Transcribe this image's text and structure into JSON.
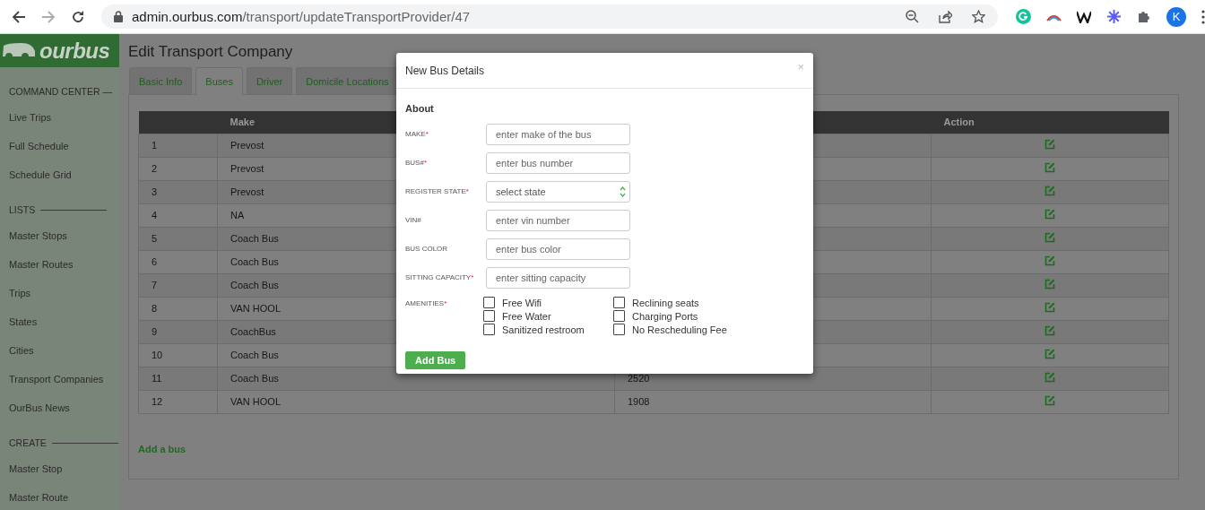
{
  "browser": {
    "url_host": "admin.ourbus.com",
    "url_path": "/transport/updateTransportProvider/47",
    "forward_disabled": true,
    "avatar_letter": "K"
  },
  "logo": {
    "text": "ourbus"
  },
  "sidebar": {
    "sections": [
      {
        "heading": "COMMAND CENTER —",
        "rule": false,
        "items": [
          "Live Trips",
          "Full Schedule",
          "Schedule Grid"
        ]
      },
      {
        "heading": "LISTS",
        "rule": true,
        "items": [
          "Master Stops",
          "Master Routes",
          "Trips",
          "States",
          "Cities",
          "Transport Companies",
          "OurBus News"
        ]
      },
      {
        "heading": "CREATE",
        "rule": true,
        "items": [
          "Master Stop",
          "Master Route"
        ]
      }
    ]
  },
  "page_title": "Edit Transport Company",
  "tabs": [
    {
      "label": "Basic Info",
      "selected": false
    },
    {
      "label": "Buses",
      "selected": true
    },
    {
      "label": "Driver",
      "selected": false
    },
    {
      "label": "Domicile Locations",
      "selected": false
    }
  ],
  "table": {
    "columns": {
      "make": "Make",
      "action": "Action"
    },
    "rows": [
      {
        "number": "1",
        "make": "Prevost"
      },
      {
        "number": "2",
        "make": "Prevost"
      },
      {
        "number": "3",
        "make": "Prevost"
      },
      {
        "number": "4",
        "make": "NA"
      },
      {
        "number": "5",
        "make": "Coach Bus"
      },
      {
        "number": "6",
        "make": "Coach Bus"
      },
      {
        "number": "7",
        "make": "Coach Bus"
      },
      {
        "number": "8",
        "make": "VAN HOOL"
      },
      {
        "number": "9",
        "make": "CoachBus"
      },
      {
        "number": "10",
        "make": "Coach Bus"
      },
      {
        "number": "11",
        "make": "Coach Bus",
        "column_3": "2520"
      },
      {
        "number": "12",
        "make": "VAN HOOL",
        "column_3": "1908"
      }
    ]
  },
  "add_link": "Add a bus",
  "modal": {
    "title": "New Bus Details",
    "close": "×",
    "section": "About",
    "fields": [
      {
        "kind": "text",
        "label": "MAKE",
        "required_mark": "*",
        "placeholder": "enter make of the bus"
      },
      {
        "kind": "text",
        "label": "BUS#",
        "required_mark": "*",
        "placeholder": "enter bus number"
      },
      {
        "kind": "select",
        "label": "REGISTER STATE",
        "required_mark": "*",
        "value": "select state"
      },
      {
        "kind": "text",
        "label": "VIN#",
        "placeholder": "enter vin number"
      },
      {
        "kind": "text",
        "label": "BUS COLOR",
        "placeholder": "enter bus color"
      },
      {
        "kind": "text",
        "label": "SITTING CAPACITY",
        "required_mark": "*",
        "placeholder": "enter sitting capacity"
      }
    ],
    "amenities": {
      "label": "AMENITIES",
      "required_mark": "*",
      "columns": [
        [
          {
            "label": "Free Wifi",
            "checked": false
          },
          {
            "label": "Free Water",
            "checked": false
          },
          {
            "label": "Sanitized restroom",
            "checked": false
          }
        ],
        [
          {
            "label": "Reclining seats",
            "checked": false
          },
          {
            "label": "Charging Ports",
            "checked": false
          },
          {
            "label": "No Rescheduling Fee",
            "checked": false
          }
        ]
      ]
    },
    "submit": "Add Bus"
  }
}
